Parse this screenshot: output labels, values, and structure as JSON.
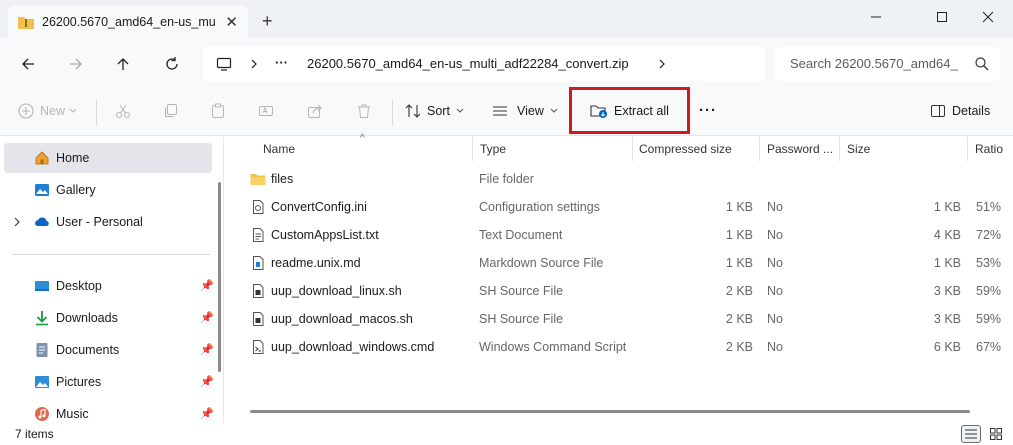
{
  "window": {
    "tab_title": "26200.5670_amd64_en-us_mu",
    "new_tab_symbol": "+",
    "close_tab_symbol": "✕"
  },
  "address": {
    "ellipsis": "···",
    "path": "26200.5670_amd64_en-us_multi_adf22284_convert.zip",
    "search_placeholder": "Search 26200.5670_amd64_"
  },
  "commands": {
    "new_label": "New",
    "sort_label": "Sort",
    "view_label": "View",
    "extract_label": "Extract all",
    "more_label": "···",
    "details_label": "Details"
  },
  "sidebar": {
    "items": [
      {
        "label": "Home",
        "icon": "home-icon"
      },
      {
        "label": "Gallery",
        "icon": "gallery-icon"
      },
      {
        "label": "User - Personal",
        "icon": "onedrive-icon"
      },
      {
        "label": "Desktop",
        "icon": "desktop-icon"
      },
      {
        "label": "Downloads",
        "icon": "downloads-icon"
      },
      {
        "label": "Documents",
        "icon": "documents-icon"
      },
      {
        "label": "Pictures",
        "icon": "pictures-icon"
      },
      {
        "label": "Music",
        "icon": "music-icon"
      }
    ]
  },
  "columns": {
    "name": "Name",
    "type": "Type",
    "compressed": "Compressed size",
    "password": "Password ...",
    "size": "Size",
    "ratio": "Ratio"
  },
  "files": [
    {
      "name": "files",
      "type": "File folder",
      "compressed": "",
      "password": "",
      "size": "",
      "ratio": "",
      "icon": "folder-icon"
    },
    {
      "name": "ConvertConfig.ini",
      "type": "Configuration settings",
      "compressed": "1 KB",
      "password": "No",
      "size": "1 KB",
      "ratio": "51%",
      "icon": "settings-file-icon"
    },
    {
      "name": "CustomAppsList.txt",
      "type": "Text Document",
      "compressed": "1 KB",
      "password": "No",
      "size": "4 KB",
      "ratio": "72%",
      "icon": "text-file-icon"
    },
    {
      "name": "readme.unix.md",
      "type": "Markdown Source File",
      "compressed": "1 KB",
      "password": "No",
      "size": "1 KB",
      "ratio": "53%",
      "icon": "markdown-file-icon"
    },
    {
      "name": "uup_download_linux.sh",
      "type": "SH Source File",
      "compressed": "2 KB",
      "password": "No",
      "size": "3 KB",
      "ratio": "59%",
      "icon": "script-file-icon"
    },
    {
      "name": "uup_download_macos.sh",
      "type": "SH Source File",
      "compressed": "2 KB",
      "password": "No",
      "size": "3 KB",
      "ratio": "59%",
      "icon": "script-file-icon"
    },
    {
      "name": "uup_download_windows.cmd",
      "type": "Windows Command Script",
      "compressed": "2 KB",
      "password": "No",
      "size": "6 KB",
      "ratio": "67%",
      "icon": "cmd-file-icon"
    }
  ],
  "status": {
    "item_count": "7 items"
  },
  "colors": {
    "accent": "#0067c0",
    "highlight_border": "#d11a1f",
    "folder": "#f3c14b",
    "selected_bg": "#e3e5ea"
  }
}
